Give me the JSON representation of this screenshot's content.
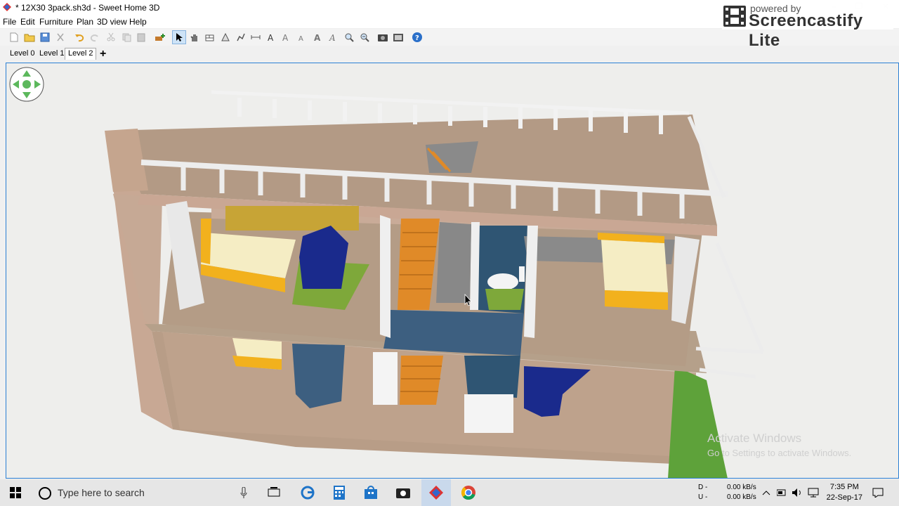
{
  "window": {
    "title": "* 12X30 3pack.sh3d - Sweet Home 3D",
    "controls": [
      "–",
      "❐",
      "✕"
    ]
  },
  "watermark": {
    "small": "powered by",
    "big": "Screencastify Lite"
  },
  "menu": {
    "file": "File",
    "edit": "Edit",
    "furniture": "Furniture",
    "plan": "Plan",
    "view3d": "3D view",
    "help": "Help"
  },
  "toolbar": {
    "icons": [
      "new-home-icon",
      "open-icon",
      "save-icon",
      "cut-icon",
      "undo-icon",
      "redo-icon",
      "copy-icon",
      "paste-icon",
      "add-furniture-icon",
      "select-icon",
      "pan-icon",
      "create-walls-icon",
      "create-rooms-icon",
      "create-polylines-icon",
      "create-dimensions-icon",
      "add-text-icon",
      "increase-text-icon",
      "decrease-text-icon",
      "bold-text-icon",
      "italic-text-icon",
      "zoom-in-icon",
      "zoom-out-icon",
      "create-photo-icon",
      "create-video-icon",
      "help-icon"
    ],
    "active": "select-icon"
  },
  "levels": {
    "tabs": [
      "Level 0",
      "Level 1",
      "Level 2"
    ],
    "selected": "Level 2",
    "add": "+"
  },
  "watermark_os": {
    "line1": "Activate Windows",
    "line2": "Go to Settings to activate Windows."
  },
  "taskbar": {
    "search_placeholder": "Type here to search",
    "net_d_label": "D -",
    "net_u_label": "U -",
    "net_d_value": "0.00 kB/s",
    "net_u_value": "0.00 kB/s",
    "time": "7:35 PM",
    "date": "22-Sep-17"
  },
  "colors": {
    "accent": "#2a7fd4",
    "wall": "#c9ab98",
    "floor": "#b29a84",
    "bed_frame": "#f2b11d",
    "sofa": "#1a2a8c",
    "stairs": "#e08a28",
    "tile": "#3d5f80"
  }
}
